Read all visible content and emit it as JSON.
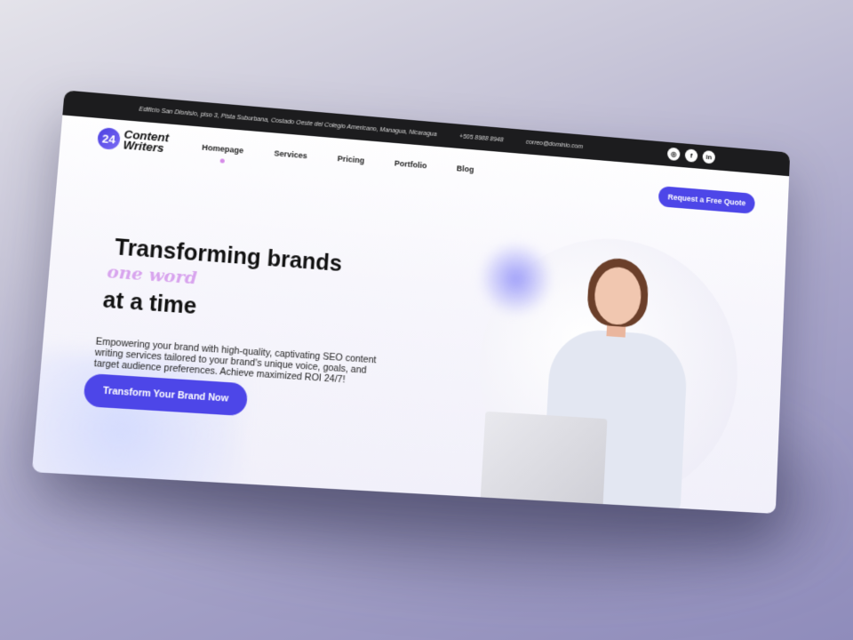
{
  "topbar": {
    "address": "Edificio San Dionisio, piso 3, Pista Suburbana, Costado Oeste del Colegio Americano, Managua, Nicaragua",
    "phone": "+505 8988 8948",
    "email": "correo@dominio.com"
  },
  "social": {
    "instagram_icon": "◎",
    "facebook_icon": "f",
    "linkedin_icon": "in"
  },
  "logo": {
    "mark": "24",
    "line1": "Content",
    "line2": "Writers"
  },
  "nav": {
    "items": [
      {
        "label": "Homepage"
      },
      {
        "label": "Services"
      },
      {
        "label": "Pricing"
      },
      {
        "label": "Portfolio"
      },
      {
        "label": "Blog"
      }
    ],
    "active": "Homepage",
    "cta_label": "Request a Free Quote"
  },
  "hero": {
    "line1": "Transforming brands",
    "accent": "one word",
    "line3": "at a time",
    "description": "Empowering your brand with high-quality, captivating SEO content writing services tailored to your brand's unique voice, goals, and target audience preferences. Achieve maximized ROI 24/7!",
    "cta_label": "Transform Your Brand Now"
  },
  "colors": {
    "primary": "#4d46e8",
    "accent": "#d8a4ee",
    "topbar_bg": "#1c1c1e"
  }
}
